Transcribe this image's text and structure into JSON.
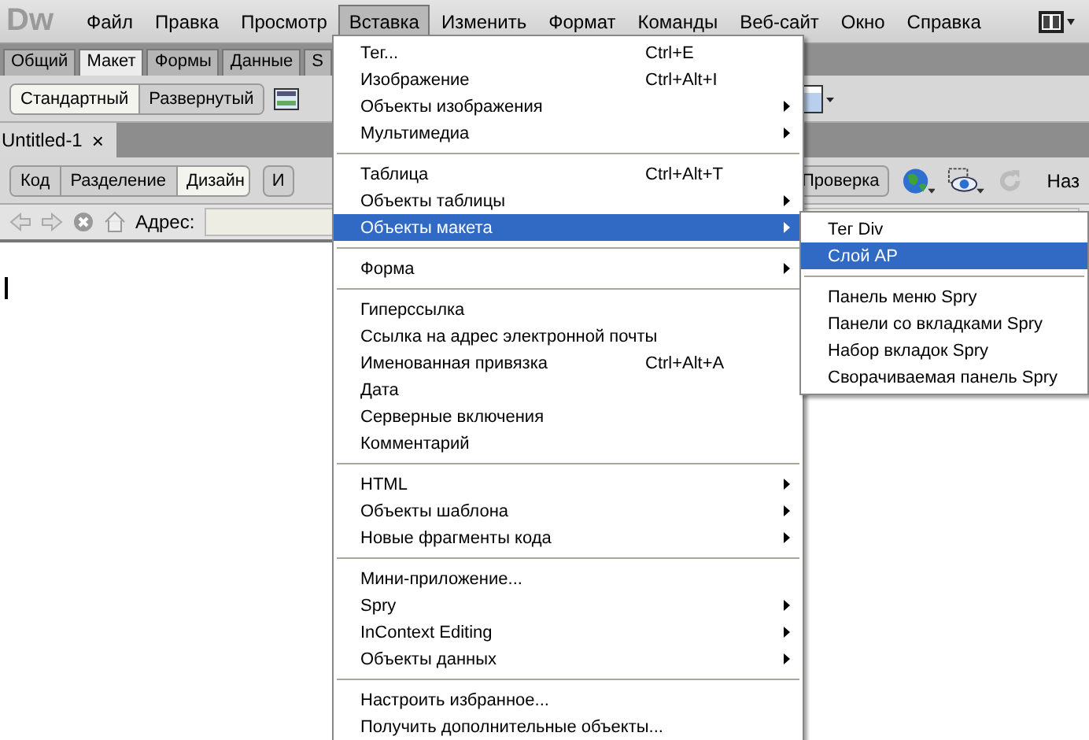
{
  "app": {
    "logo": "Dw"
  },
  "menu_bar": [
    {
      "label": "Файл",
      "selected": false
    },
    {
      "label": "Правка",
      "selected": false
    },
    {
      "label": "Просмотр",
      "selected": false
    },
    {
      "label": "Вставка",
      "selected": true
    },
    {
      "label": "Изменить",
      "selected": false
    },
    {
      "label": "Формат",
      "selected": false
    },
    {
      "label": "Команды",
      "selected": false
    },
    {
      "label": "Веб-сайт",
      "selected": false
    },
    {
      "label": "Окно",
      "selected": false
    },
    {
      "label": "Справка",
      "selected": false
    }
  ],
  "insert_bar": {
    "tabs": [
      {
        "label": "Общий",
        "selected": false
      },
      {
        "label": "Макет",
        "selected": true
      },
      {
        "label": "Формы",
        "selected": false
      },
      {
        "label": "Данные",
        "selected": false
      },
      {
        "label": "S",
        "selected": false
      }
    ],
    "modes": [
      {
        "label": "Стандартный",
        "selected": true
      },
      {
        "label": "Развернутый",
        "selected": false
      }
    ]
  },
  "document_tab": {
    "title": "Untitled-1",
    "close": "×"
  },
  "document_toolbar": {
    "views": [
      {
        "label": "Код",
        "selected": false
      },
      {
        "label": "Разделение",
        "selected": false
      },
      {
        "label": "Дизайн",
        "selected": true
      }
    ],
    "partial_button": "И",
    "check_button": "Проверка",
    "title_label": "Наз"
  },
  "address_bar": {
    "label": "Адрес:"
  },
  "insert_menu": {
    "items": [
      {
        "kind": "item",
        "label": "Тег...",
        "shortcut": "Ctrl+E",
        "submenu": false,
        "selected": false
      },
      {
        "kind": "item",
        "label": "Изображение",
        "shortcut": "Ctrl+Alt+I",
        "submenu": false,
        "selected": false
      },
      {
        "kind": "item",
        "label": "Объекты изображения",
        "submenu": true,
        "selected": false
      },
      {
        "kind": "item",
        "label": "Мультимедиа",
        "submenu": true,
        "selected": false
      },
      {
        "kind": "separator"
      },
      {
        "kind": "item",
        "label": "Таблица",
        "shortcut": "Ctrl+Alt+T",
        "submenu": false,
        "selected": false
      },
      {
        "kind": "item",
        "label": "Объекты таблицы",
        "submenu": true,
        "selected": false
      },
      {
        "kind": "item",
        "label": "Объекты макета",
        "submenu": true,
        "selected": true
      },
      {
        "kind": "separator"
      },
      {
        "kind": "item",
        "label": "Форма",
        "submenu": true,
        "selected": false
      },
      {
        "kind": "separator"
      },
      {
        "kind": "item",
        "label": "Гиперссылка",
        "submenu": false,
        "selected": false
      },
      {
        "kind": "item",
        "label": "Ссылка на адрес электронной почты",
        "submenu": false,
        "selected": false
      },
      {
        "kind": "item",
        "label": "Именованная привязка",
        "shortcut": "Ctrl+Alt+A",
        "submenu": false,
        "selected": false
      },
      {
        "kind": "item",
        "label": "Дата",
        "submenu": false,
        "selected": false
      },
      {
        "kind": "item",
        "label": "Серверные включения",
        "submenu": false,
        "selected": false
      },
      {
        "kind": "item",
        "label": "Комментарий",
        "submenu": false,
        "selected": false
      },
      {
        "kind": "separator"
      },
      {
        "kind": "item",
        "label": "HTML",
        "submenu": true,
        "selected": false
      },
      {
        "kind": "item",
        "label": "Объекты шаблона",
        "submenu": true,
        "selected": false
      },
      {
        "kind": "item",
        "label": "Новые фрагменты кода",
        "submenu": true,
        "selected": false
      },
      {
        "kind": "separator"
      },
      {
        "kind": "item",
        "label": "Мини-приложение...",
        "submenu": false,
        "selected": false
      },
      {
        "kind": "item",
        "label": "Spry",
        "submenu": true,
        "selected": false
      },
      {
        "kind": "item",
        "label": "InContext Editing",
        "submenu": true,
        "selected": false
      },
      {
        "kind": "item",
        "label": "Объекты данных",
        "submenu": true,
        "selected": false
      },
      {
        "kind": "separator"
      },
      {
        "kind": "item",
        "label": "Настроить избранное...",
        "submenu": false,
        "selected": false
      },
      {
        "kind": "item",
        "label": "Получить дополнительные объекты...",
        "submenu": false,
        "selected": false
      }
    ]
  },
  "layout_submenu": {
    "items": [
      {
        "kind": "item",
        "label": "Тег Div",
        "selected": false
      },
      {
        "kind": "item",
        "label": "Слой AP",
        "selected": true
      },
      {
        "kind": "separator"
      },
      {
        "kind": "item",
        "label": "Панель меню Spry",
        "selected": false
      },
      {
        "kind": "item",
        "label": "Панели со вкладками Spry",
        "selected": false
      },
      {
        "kind": "item",
        "label": "Набор вкладок Spry",
        "selected": false
      },
      {
        "kind": "item",
        "label": "Сворачиваемая панель Spry",
        "selected": false
      }
    ]
  }
}
